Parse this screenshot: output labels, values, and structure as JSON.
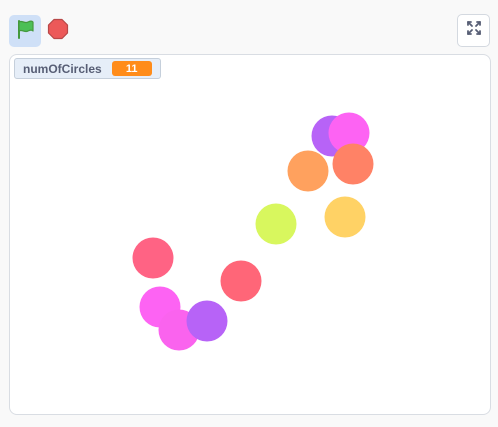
{
  "toolbar": {
    "green_flag_icon": "green-flag-icon",
    "stop_icon": "stop-icon",
    "fullscreen_icon": "fullscreen-icon"
  },
  "monitor": {
    "name": "numOfCircles",
    "value": "11",
    "value_color": "#ff8c1a"
  },
  "sprites": [
    {
      "name": "circle",
      "color": "#b763f7"
    },
    {
      "name": "circle",
      "color": "#fd63f3"
    },
    {
      "name": "circle",
      "color": "#ffa15e"
    },
    {
      "name": "circle",
      "color": "#ff8266"
    },
    {
      "name": "circle",
      "color": "#d8f75e"
    },
    {
      "name": "circle",
      "color": "#ffd265"
    },
    {
      "name": "circle",
      "color": "#ff6384"
    },
    {
      "name": "circle",
      "color": "#ff6678"
    },
    {
      "name": "circle",
      "color": "#fd63f3"
    },
    {
      "name": "circle",
      "color": "#fa63ee"
    },
    {
      "name": "circle",
      "color": "#b763f7"
    }
  ]
}
